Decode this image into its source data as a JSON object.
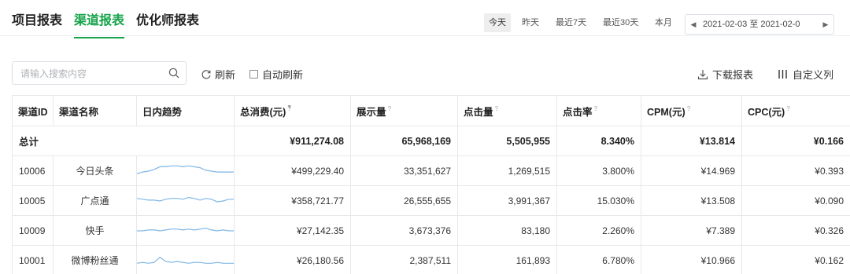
{
  "tabs": [
    {
      "label": "项目报表",
      "active": false
    },
    {
      "label": "渠道报表",
      "active": true
    },
    {
      "label": "优化师报表",
      "active": false
    }
  ],
  "date_tabs": [
    {
      "label": "今天",
      "active": true
    },
    {
      "label": "昨天",
      "active": false
    },
    {
      "label": "最近7天",
      "active": false
    },
    {
      "label": "最近30天",
      "active": false
    },
    {
      "label": "本月",
      "active": false
    }
  ],
  "date_range": {
    "text": "2021-02-03 至 2021-02-0"
  },
  "toolbar": {
    "search_placeholder": "请输入搜索内容",
    "refresh_label": "刷新",
    "auto_refresh_label": "自动刷新",
    "download_label": "下载报表",
    "custom_label": "自定义列"
  },
  "table": {
    "headers": [
      "渠道ID",
      "渠道名称",
      "日内趋势",
      "总消费(元)",
      "展示量",
      "点击量",
      "点击率",
      "CPM(元)",
      "CPC(元)"
    ],
    "total": {
      "label": "总计",
      "spend": "¥911,274.08",
      "impressions": "65,968,169",
      "clicks": "5,505,955",
      "ctr": "8.340%",
      "cpm": "¥13.814",
      "cpc": "¥0.166"
    },
    "rows": [
      {
        "id": "10006",
        "name": "今日头条",
        "spend": "¥499,229.40",
        "impressions": "33,351,627",
        "clicks": "1,269,515",
        "ctr": "3.800%",
        "cpm": "¥14.969",
        "cpc": "¥0.393",
        "trend": [
          6,
          8,
          9,
          11,
          14,
          14,
          15,
          15,
          14,
          15,
          14,
          13,
          10,
          9,
          8,
          8,
          8,
          8
        ]
      },
      {
        "id": "10005",
        "name": "广点通",
        "spend": "¥358,721.77",
        "impressions": "26,555,655",
        "clicks": "3,991,367",
        "ctr": "15.030%",
        "cpm": "¥13.508",
        "cpc": "¥0.090",
        "trend": [
          12,
          11,
          10,
          10,
          9,
          11,
          12,
          12,
          11,
          13,
          12,
          10,
          12,
          11,
          8,
          9,
          11,
          11
        ]
      },
      {
        "id": "10009",
        "name": "快手",
        "spend": "¥27,142.35",
        "impressions": "3,673,376",
        "clicks": "83,180",
        "ctr": "2.260%",
        "cpm": "¥7.389",
        "cpc": "¥0.326",
        "trend": [
          9,
          9,
          10,
          10,
          9,
          10,
          11,
          11,
          10,
          11,
          10,
          11,
          12,
          10,
          9,
          10,
          9,
          9
        ]
      },
      {
        "id": "10001",
        "name": "微博粉丝通",
        "spend": "¥26,180.56",
        "impressions": "2,387,511",
        "clicks": "161,893",
        "ctr": "6.780%",
        "cpm": "¥10.966",
        "cpc": "¥0.162",
        "trend": [
          6,
          7,
          6,
          7,
          13,
          8,
          7,
          8,
          7,
          6,
          7,
          7,
          6,
          6,
          7,
          6,
          6,
          6
        ]
      }
    ]
  },
  "colors": {
    "accent": "#16a34a",
    "sparkline": "#7fb6e6"
  }
}
